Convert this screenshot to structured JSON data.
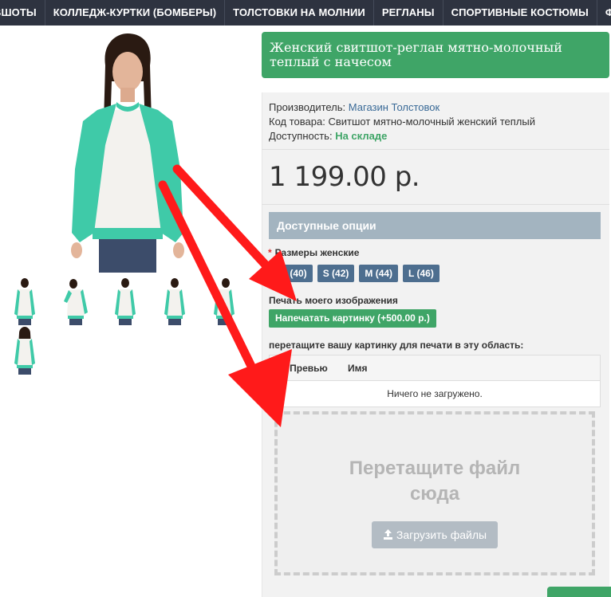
{
  "nav": {
    "items": [
      "ВШОТЫ",
      "КОЛЛЕДЖ-КУРТКИ (БОМБЕРЫ)",
      "ТОЛСТОВКИ НА МОЛНИИ",
      "РЕГЛАНЫ",
      "СПОРТИВНЫЕ КОСТЮМЫ",
      "Ф"
    ]
  },
  "product": {
    "title": "Женский свитшот-реглан мятно-молочный теплый с начесом",
    "manufacturer_label": "Производитель:",
    "manufacturer_value": "Магазин Толстовок",
    "code_label": "Код товара:",
    "code_value": "Свитшот мятно-молочный женский теплый",
    "availability_label": "Доступность:",
    "availability_value": "На складе",
    "price": "1 199.00 р."
  },
  "options": {
    "header": "Доступные опции",
    "sizes_label": "Размеры женские",
    "required_mark": "*",
    "sizes": [
      "XS (40)",
      "S (42)",
      "M (44)",
      "L (46)"
    ],
    "print_label": "Печать моего изображения",
    "print_button": "Напечатать картинку (+500.00 р.)",
    "drop_label": "перетащите вашу картинку для печати в эту область:"
  },
  "upload": {
    "col_preview": "Превью",
    "col_name": "Имя",
    "empty_text": "Ничего не загружено.",
    "drop_text_line1": "Перетащите файл",
    "drop_text_line2": "сюда",
    "upload_button": "Загрузить файлы"
  },
  "colors": {
    "nav_bg": "#2e3340",
    "title_bg": "#3fa567",
    "size_btn": "#4d6e8f",
    "options_header": "#a3b4c0",
    "arrow": "#ff1a1a",
    "mint": "#3fcaa8"
  },
  "icons": {
    "upload": "upload-icon"
  }
}
